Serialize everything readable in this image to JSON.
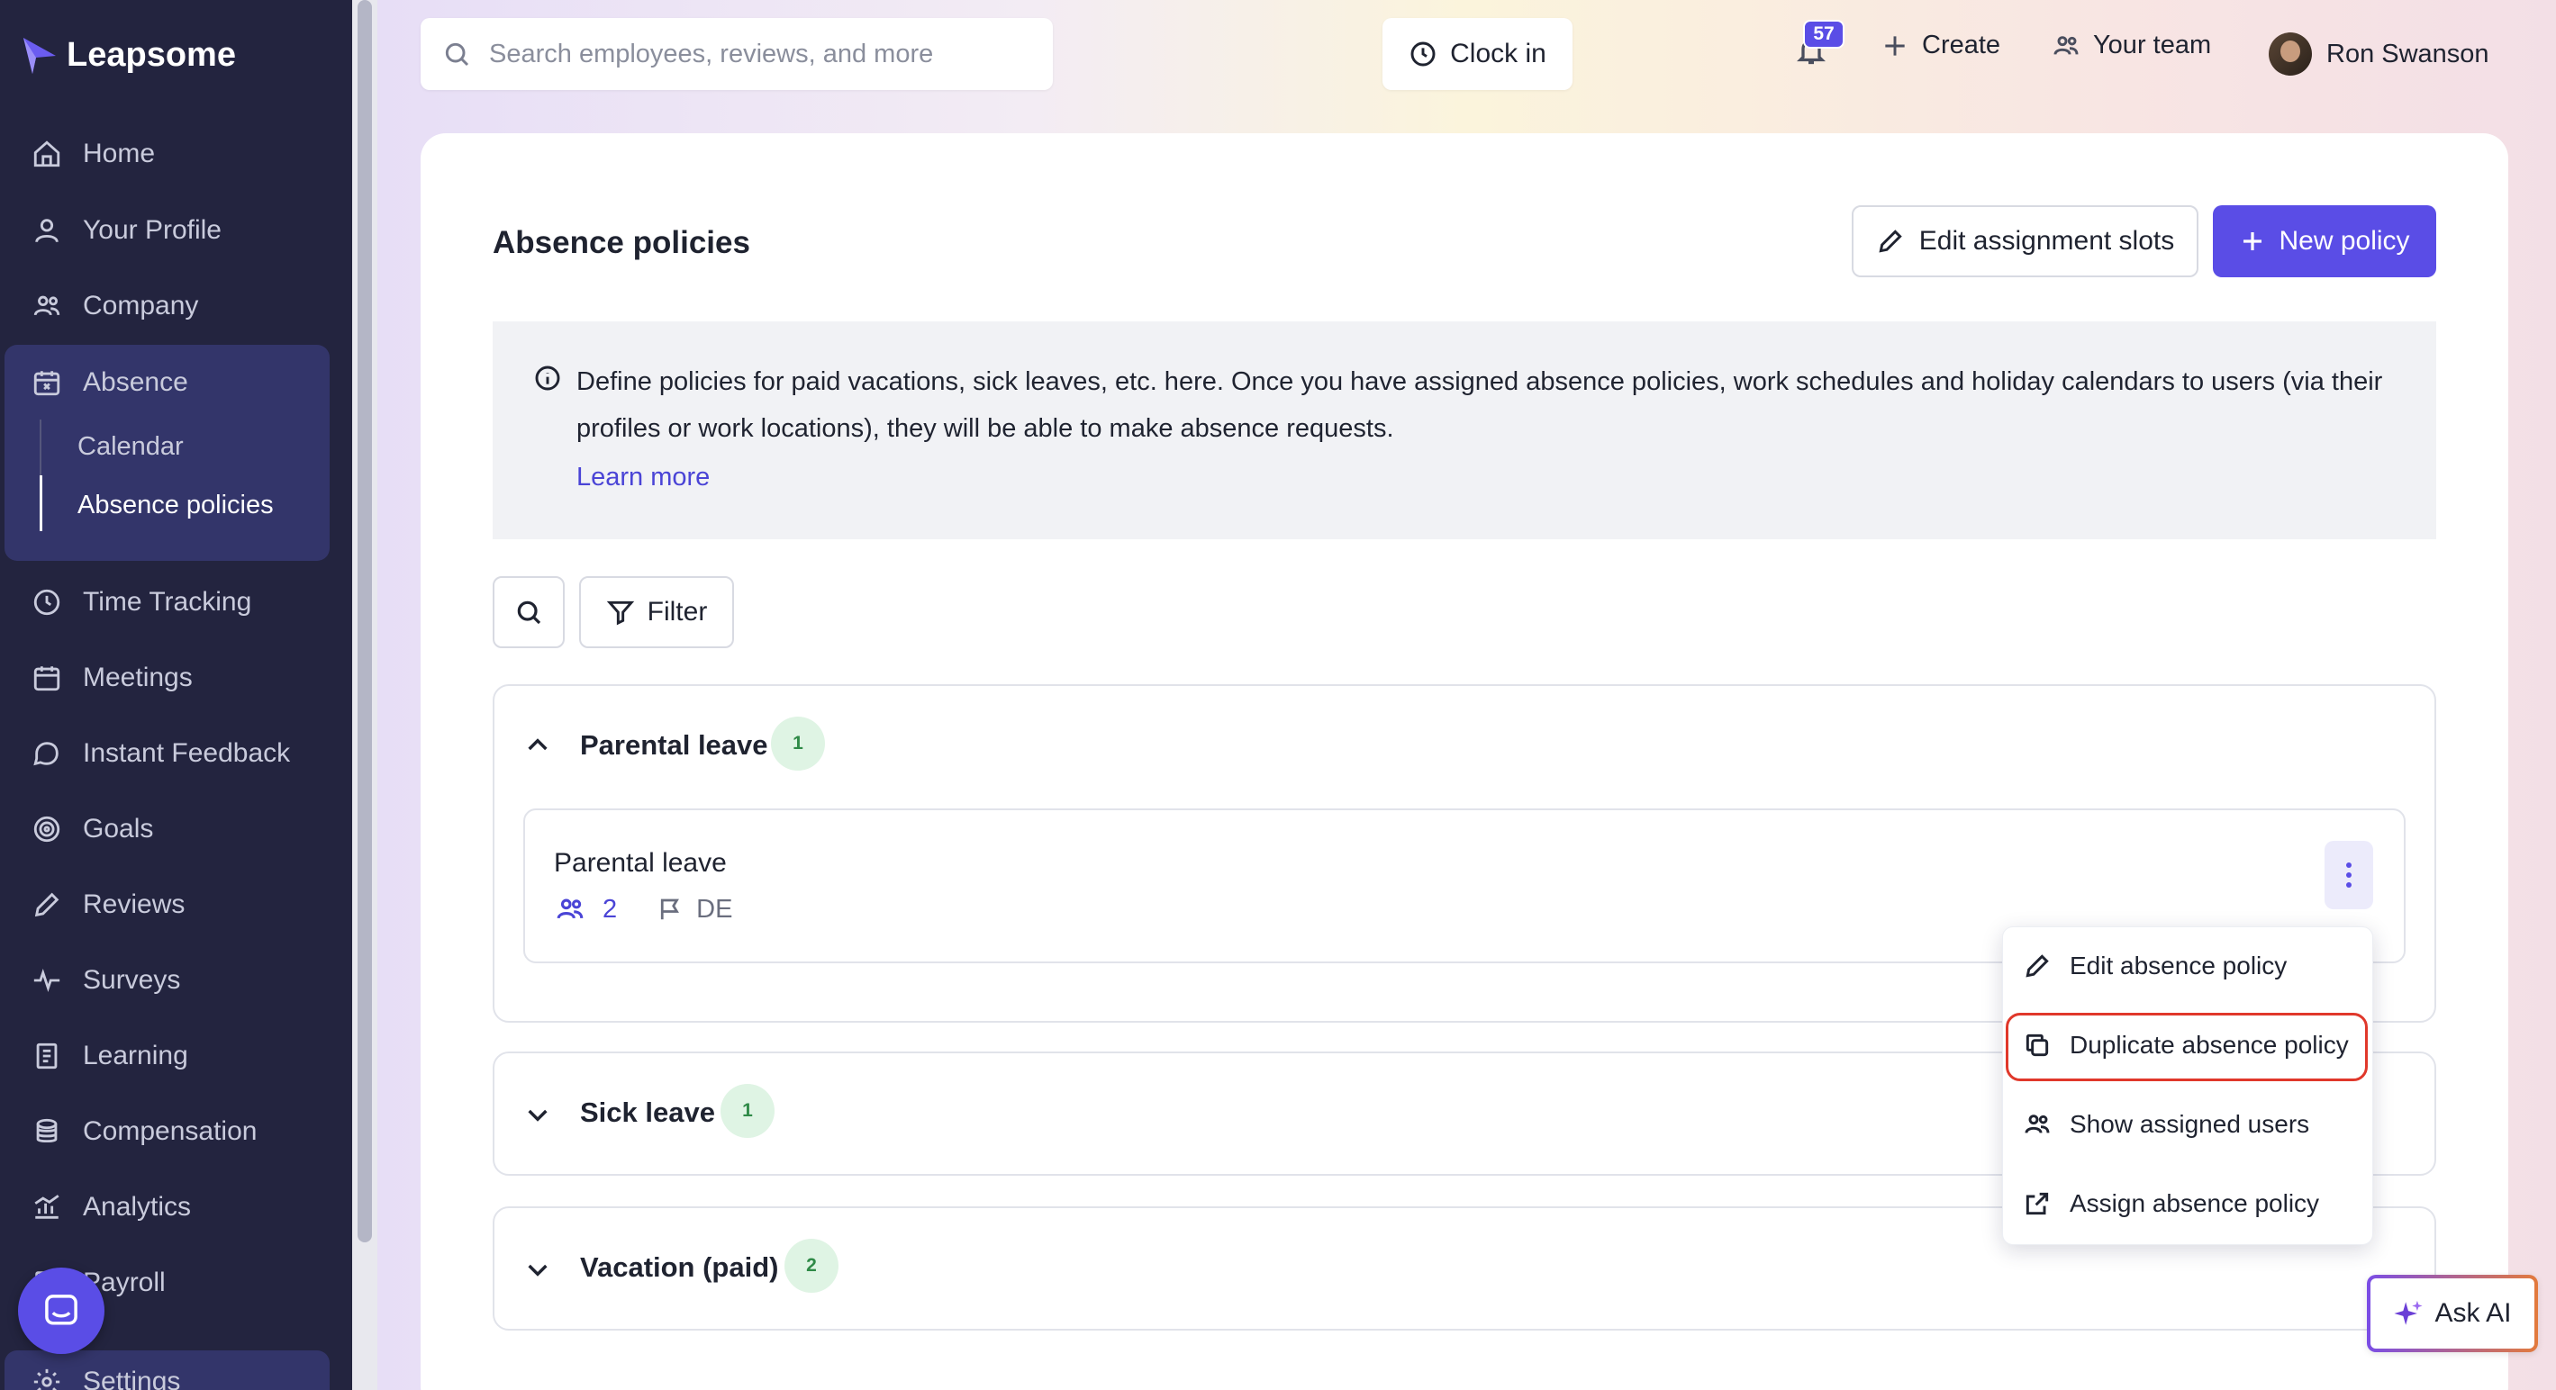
{
  "brand": {
    "name": "Leapsome",
    "accent": "#5a4de6",
    "sidebar_bg": "#23243f"
  },
  "sidebar": {
    "items": [
      {
        "label": "Home",
        "icon": "home-icon"
      },
      {
        "label": "Your Profile",
        "icon": "user-icon"
      },
      {
        "label": "Company",
        "icon": "people-icon"
      },
      {
        "label": "Absence",
        "icon": "calendar-x-icon",
        "active": true,
        "children": [
          {
            "label": "Calendar"
          },
          {
            "label": "Absence policies",
            "active": true
          }
        ]
      },
      {
        "label": "Time Tracking",
        "icon": "clock-icon"
      },
      {
        "label": "Meetings",
        "icon": "calendar-icon"
      },
      {
        "label": "Instant Feedback",
        "icon": "chat-icon"
      },
      {
        "label": "Goals",
        "icon": "target-icon"
      },
      {
        "label": "Reviews",
        "icon": "pencil-icon"
      },
      {
        "label": "Surveys",
        "icon": "pulse-icon"
      },
      {
        "label": "Learning",
        "icon": "book-icon"
      },
      {
        "label": "Compensation",
        "icon": "coins-icon"
      },
      {
        "label": "Analytics",
        "icon": "analytics-icon"
      },
      {
        "label": "Payroll",
        "icon": "payroll-icon"
      },
      {
        "label": "Settings",
        "icon": "gear-icon"
      }
    ]
  },
  "topbar": {
    "search_placeholder": "Search employees, reviews, and more",
    "clock_in": "Clock in",
    "notifications_count": "57",
    "create": "Create",
    "your_team": "Your team",
    "user_name": "Ron Swanson"
  },
  "page": {
    "title": "Absence policies",
    "edit_slots": "Edit assignment slots",
    "new_policy": "New policy",
    "info_text": "Define policies for paid vacations, sick leaves, etc. here. Once you have assigned absence policies, work schedules and holiday calendars to users (via their profiles or work locations), they will be able to make absence requests.",
    "learn_more": "Learn more",
    "filter": "Filter"
  },
  "groups": [
    {
      "title": "Parental leave",
      "count": "1",
      "expanded": true,
      "policies": [
        {
          "name": "Parental leave",
          "users": "2",
          "country": "DE"
        }
      ]
    },
    {
      "title": "Sick leave",
      "count": "1",
      "expanded": false
    },
    {
      "title": "Vacation (paid)",
      "count": "2",
      "expanded": false
    }
  ],
  "menu": {
    "items": [
      {
        "label": "Edit absence policy",
        "icon": "pencil-icon"
      },
      {
        "label": "Duplicate absence policy",
        "icon": "duplicate-icon",
        "highlighted": true
      },
      {
        "label": "Show assigned users",
        "icon": "people-icon"
      },
      {
        "label": "Assign absence policy",
        "icon": "external-link-icon"
      }
    ]
  },
  "ask_ai": "Ask AI"
}
